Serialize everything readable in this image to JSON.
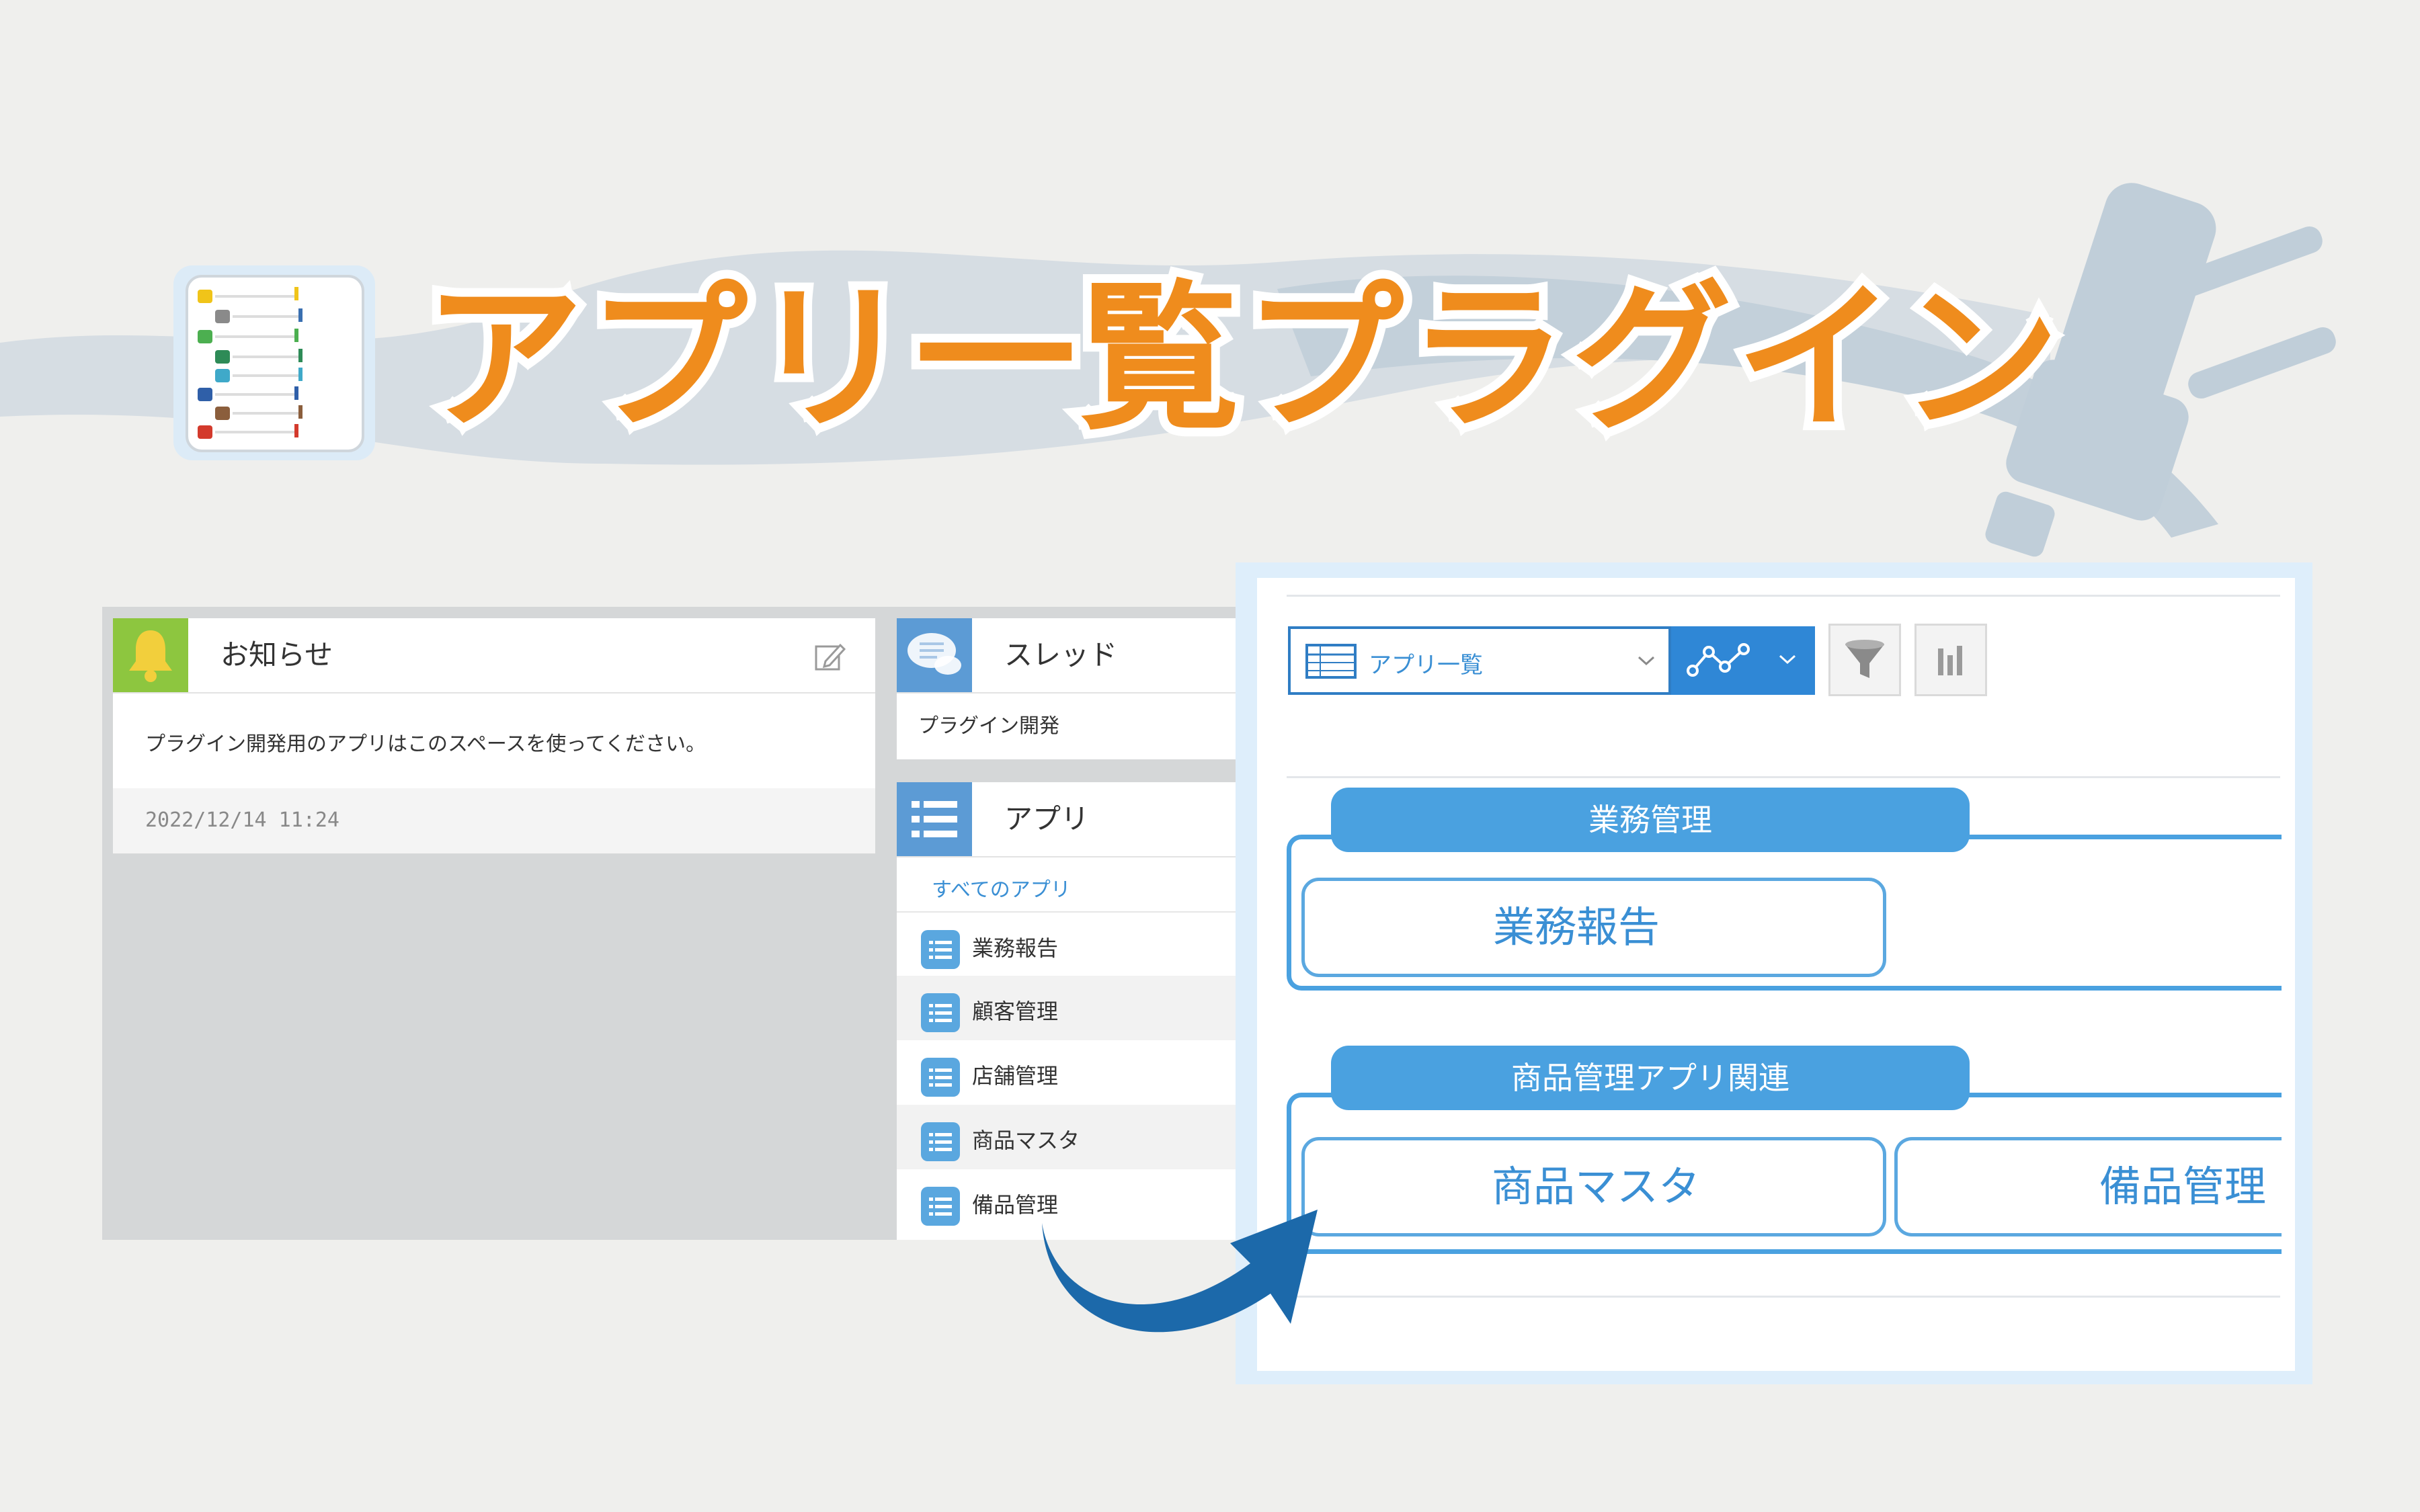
{
  "title": "アプリ一覧プラグイン",
  "colors": {
    "accent": "#ef8c1d",
    "blue": "#2f87d6",
    "light_blue": "#4aa1e0"
  },
  "notice": {
    "header": "お知らせ",
    "body": "プラグイン開発用のアプリはこのスペースを使ってください。",
    "date": "2022/12/14 11:24",
    "icons": {
      "header": "bell-icon",
      "edit": "edit-icon"
    }
  },
  "thread": {
    "header": "スレッド",
    "item": "プラグイン開発",
    "icon": "speech-bubbles-icon"
  },
  "apps": {
    "header": "アプリ",
    "all_apps": "すべてのアプリ",
    "icon": "list-icon",
    "items": [
      {
        "label": "業務報告"
      },
      {
        "label": "顧客管理"
      },
      {
        "label": "店舗管理"
      },
      {
        "label": "商品マスタ"
      },
      {
        "label": "備品管理"
      }
    ]
  },
  "zoom": {
    "view_select": "アプリ一覧",
    "icons": {
      "view": "table-icon",
      "graph": "line-chart-icon",
      "filter": "funnel-icon",
      "summary": "bar-chart-icon"
    },
    "groups": [
      {
        "name": "業務管理",
        "apps": [
          "業務報告"
        ]
      },
      {
        "name": "商品管理アプリ関連",
        "apps": [
          "商品マスタ",
          "備品管理"
        ]
      }
    ]
  }
}
